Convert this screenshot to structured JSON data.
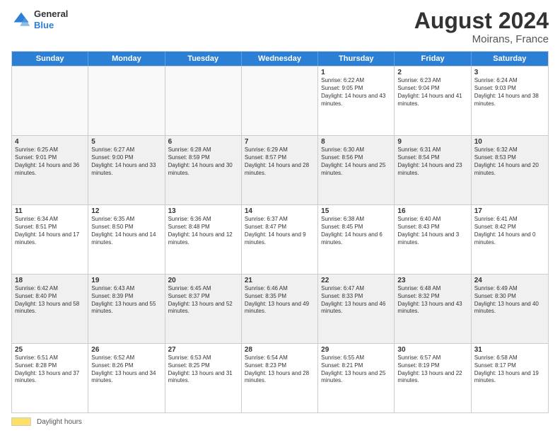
{
  "header": {
    "logo_general": "General",
    "logo_blue": "Blue",
    "month_title": "August 2024",
    "location": "Moirans, France"
  },
  "days_of_week": [
    "Sunday",
    "Monday",
    "Tuesday",
    "Wednesday",
    "Thursday",
    "Friday",
    "Saturday"
  ],
  "footer": {
    "daylight_label": "Daylight hours"
  },
  "weeks": [
    [
      {
        "day": "",
        "text": ""
      },
      {
        "day": "",
        "text": ""
      },
      {
        "day": "",
        "text": ""
      },
      {
        "day": "",
        "text": ""
      },
      {
        "day": "1",
        "text": "Sunrise: 6:22 AM\nSunset: 9:05 PM\nDaylight: 14 hours and 43 minutes."
      },
      {
        "day": "2",
        "text": "Sunrise: 6:23 AM\nSunset: 9:04 PM\nDaylight: 14 hours and 41 minutes."
      },
      {
        "day": "3",
        "text": "Sunrise: 6:24 AM\nSunset: 9:03 PM\nDaylight: 14 hours and 38 minutes."
      }
    ],
    [
      {
        "day": "4",
        "text": "Sunrise: 6:25 AM\nSunset: 9:01 PM\nDaylight: 14 hours and 36 minutes."
      },
      {
        "day": "5",
        "text": "Sunrise: 6:27 AM\nSunset: 9:00 PM\nDaylight: 14 hours and 33 minutes."
      },
      {
        "day": "6",
        "text": "Sunrise: 6:28 AM\nSunset: 8:59 PM\nDaylight: 14 hours and 30 minutes."
      },
      {
        "day": "7",
        "text": "Sunrise: 6:29 AM\nSunset: 8:57 PM\nDaylight: 14 hours and 28 minutes."
      },
      {
        "day": "8",
        "text": "Sunrise: 6:30 AM\nSunset: 8:56 PM\nDaylight: 14 hours and 25 minutes."
      },
      {
        "day": "9",
        "text": "Sunrise: 6:31 AM\nSunset: 8:54 PM\nDaylight: 14 hours and 23 minutes."
      },
      {
        "day": "10",
        "text": "Sunrise: 6:32 AM\nSunset: 8:53 PM\nDaylight: 14 hours and 20 minutes."
      }
    ],
    [
      {
        "day": "11",
        "text": "Sunrise: 6:34 AM\nSunset: 8:51 PM\nDaylight: 14 hours and 17 minutes."
      },
      {
        "day": "12",
        "text": "Sunrise: 6:35 AM\nSunset: 8:50 PM\nDaylight: 14 hours and 14 minutes."
      },
      {
        "day": "13",
        "text": "Sunrise: 6:36 AM\nSunset: 8:48 PM\nDaylight: 14 hours and 12 minutes."
      },
      {
        "day": "14",
        "text": "Sunrise: 6:37 AM\nSunset: 8:47 PM\nDaylight: 14 hours and 9 minutes."
      },
      {
        "day": "15",
        "text": "Sunrise: 6:38 AM\nSunset: 8:45 PM\nDaylight: 14 hours and 6 minutes."
      },
      {
        "day": "16",
        "text": "Sunrise: 6:40 AM\nSunset: 8:43 PM\nDaylight: 14 hours and 3 minutes."
      },
      {
        "day": "17",
        "text": "Sunrise: 6:41 AM\nSunset: 8:42 PM\nDaylight: 14 hours and 0 minutes."
      }
    ],
    [
      {
        "day": "18",
        "text": "Sunrise: 6:42 AM\nSunset: 8:40 PM\nDaylight: 13 hours and 58 minutes."
      },
      {
        "day": "19",
        "text": "Sunrise: 6:43 AM\nSunset: 8:39 PM\nDaylight: 13 hours and 55 minutes."
      },
      {
        "day": "20",
        "text": "Sunrise: 6:45 AM\nSunset: 8:37 PM\nDaylight: 13 hours and 52 minutes."
      },
      {
        "day": "21",
        "text": "Sunrise: 6:46 AM\nSunset: 8:35 PM\nDaylight: 13 hours and 49 minutes."
      },
      {
        "day": "22",
        "text": "Sunrise: 6:47 AM\nSunset: 8:33 PM\nDaylight: 13 hours and 46 minutes."
      },
      {
        "day": "23",
        "text": "Sunrise: 6:48 AM\nSunset: 8:32 PM\nDaylight: 13 hours and 43 minutes."
      },
      {
        "day": "24",
        "text": "Sunrise: 6:49 AM\nSunset: 8:30 PM\nDaylight: 13 hours and 40 minutes."
      }
    ],
    [
      {
        "day": "25",
        "text": "Sunrise: 6:51 AM\nSunset: 8:28 PM\nDaylight: 13 hours and 37 minutes."
      },
      {
        "day": "26",
        "text": "Sunrise: 6:52 AM\nSunset: 8:26 PM\nDaylight: 13 hours and 34 minutes."
      },
      {
        "day": "27",
        "text": "Sunrise: 6:53 AM\nSunset: 8:25 PM\nDaylight: 13 hours and 31 minutes."
      },
      {
        "day": "28",
        "text": "Sunrise: 6:54 AM\nSunset: 8:23 PM\nDaylight: 13 hours and 28 minutes."
      },
      {
        "day": "29",
        "text": "Sunrise: 6:55 AM\nSunset: 8:21 PM\nDaylight: 13 hours and 25 minutes."
      },
      {
        "day": "30",
        "text": "Sunrise: 6:57 AM\nSunset: 8:19 PM\nDaylight: 13 hours and 22 minutes."
      },
      {
        "day": "31",
        "text": "Sunrise: 6:58 AM\nSunset: 8:17 PM\nDaylight: 13 hours and 19 minutes."
      }
    ]
  ]
}
